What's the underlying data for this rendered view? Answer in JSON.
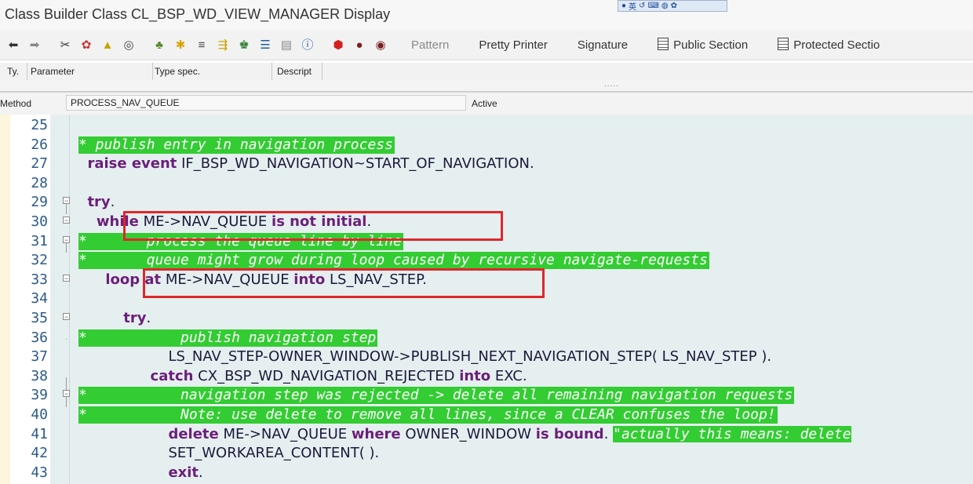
{
  "window": {
    "title": "Class Builder Class CL_BSP_WD_VIEW_MANAGER Display"
  },
  "ime_bar": {
    "icons": [
      "ime-logo-icon",
      "ime-lang-icon",
      "ime-punct-icon",
      "ime-keyboard-icon",
      "ime-mic-icon",
      "ime-settings-icon"
    ],
    "glyphs": [
      "●",
      "英",
      "↺",
      "⌨",
      "◍",
      "✿"
    ]
  },
  "toolbar": {
    "icons": [
      {
        "name": "back-arrow-icon",
        "glyph": "⬅",
        "color": "#333"
      },
      {
        "name": "forward-arrow-icon",
        "glyph": "➡",
        "color": "#888"
      },
      {
        "name": "other-object-icon",
        "glyph": "✂",
        "color": "#333"
      },
      {
        "name": "display-change-icon",
        "glyph": "✿",
        "color": "#c33"
      },
      {
        "name": "check-icon",
        "glyph": "▲",
        "color": "#c8a400"
      },
      {
        "name": "activate-icon",
        "glyph": "◎",
        "color": "#444"
      },
      {
        "name": "where-used-icon",
        "glyph": "♣",
        "color": "#5a8a2a"
      },
      {
        "name": "wand-icon",
        "glyph": "✱",
        "color": "#d9a400"
      },
      {
        "name": "display-object-list-icon",
        "glyph": "≡",
        "color": "#444"
      },
      {
        "name": "navigation-icon",
        "glyph": "⇶",
        "color": "#c8a400"
      },
      {
        "name": "hierarchy-icon",
        "glyph": "♚",
        "color": "#2a7a2a"
      },
      {
        "name": "stack-icon",
        "glyph": "☰",
        "color": "#1f5aa8"
      },
      {
        "name": "window-icon",
        "glyph": "▤",
        "color": "#888"
      },
      {
        "name": "info-icon",
        "glyph": "ⓘ",
        "color": "#1f5aa8"
      },
      {
        "name": "breakpoint-icon",
        "glyph": "⬢",
        "color": "#d31f1f"
      },
      {
        "name": "session-breakpoint-icon",
        "glyph": "●",
        "color": "#7a1f1f"
      },
      {
        "name": "external-breakpoint-icon",
        "glyph": "◉",
        "color": "#7a1f1f"
      }
    ],
    "buttons": {
      "pattern": "Pattern",
      "pretty_printer": "Pretty Printer",
      "signature": "Signature",
      "public_section": "Public Section",
      "protected_section": "Protected Sectio"
    }
  },
  "param_table": {
    "columns": [
      "Ty.",
      "Parameter",
      "Type spec.",
      "Descript"
    ]
  },
  "method_bar": {
    "label": "Method",
    "name": "PROCESS_NAV_QUEUE",
    "status": "Active"
  },
  "editor": {
    "lines": [
      {
        "n": "25"
      },
      {
        "n": "26",
        "comment": "* publish entry in navigation process"
      },
      {
        "n": "27",
        "code": [
          {
            "k": "ind",
            "t": "  "
          },
          {
            "k": "kw",
            "t": "raise event"
          },
          {
            "k": "op",
            "t": " IF_BSP_WD_NAVIGATION~START_OF_NAVIGATION."
          }
        ]
      },
      {
        "n": "28"
      },
      {
        "n": "29",
        "fold": "-",
        "code": [
          {
            "k": "ind",
            "t": "  "
          },
          {
            "k": "kw",
            "t": "try"
          },
          {
            "k": "op",
            "t": "."
          }
        ]
      },
      {
        "n": "30",
        "fold": "-",
        "code": [
          {
            "k": "ind",
            "t": "    "
          },
          {
            "k": "kw",
            "t": "while"
          },
          {
            "k": "op",
            "t": " ME->NAV_QUEUE "
          },
          {
            "k": "kw",
            "t": "is not initial"
          },
          {
            "k": "op",
            "t": "."
          }
        ]
      },
      {
        "n": "31",
        "fold": "-",
        "comment": "*       process the queue line by line"
      },
      {
        "n": "32",
        "comment": "*       queue might grow during loop caused by recursive navigate-requests"
      },
      {
        "n": "33",
        "fold": "-",
        "code": [
          {
            "k": "ind",
            "t": "      "
          },
          {
            "k": "kw",
            "t": "loop at"
          },
          {
            "k": "op",
            "t": " ME->NAV_QUEUE "
          },
          {
            "k": "kw",
            "t": "into"
          },
          {
            "k": "op",
            "t": " LS_NAV_STEP."
          }
        ]
      },
      {
        "n": "34"
      },
      {
        "n": "35",
        "fold": "-",
        "code": [
          {
            "k": "ind",
            "t": "          "
          },
          {
            "k": "kw",
            "t": "try"
          },
          {
            "k": "op",
            "t": "."
          }
        ]
      },
      {
        "n": "36",
        "comment": "*           publish navigation step"
      },
      {
        "n": "37",
        "code": [
          {
            "k": "ind",
            "t": "                    "
          },
          {
            "k": "op",
            "t": "LS_NAV_STEP-OWNER_WINDOW->PUBLISH_NEXT_NAVIGATION_STEP( LS_NAV_STEP )."
          }
        ]
      },
      {
        "n": "38",
        "code": [
          {
            "k": "ind",
            "t": "                "
          },
          {
            "k": "kw",
            "t": "catch"
          },
          {
            "k": "op",
            "t": " CX_BSP_WD_NAVIGATION_REJECTED "
          },
          {
            "k": "kw",
            "t": "into"
          },
          {
            "k": "op",
            "t": " EXC."
          }
        ]
      },
      {
        "n": "39",
        "fold": "-",
        "comment": "*           navigation step was rejected -> delete all remaining navigation requests"
      },
      {
        "n": "40",
        "comment": "*           Note: use delete to remove all lines, since a CLEAR confuses the loop!"
      },
      {
        "n": "41",
        "code": [
          {
            "k": "ind",
            "t": "                    "
          },
          {
            "k": "kw",
            "t": "delete"
          },
          {
            "k": "op",
            "t": " ME->NAV_QUEUE "
          },
          {
            "k": "kw",
            "t": "where"
          },
          {
            "k": "op",
            "t": " OWNER_WINDOW "
          },
          {
            "k": "kw",
            "t": "is bound"
          },
          {
            "k": "op",
            "t": ". "
          }
        ],
        "trailing_comment": "\"actually this means: delete"
      },
      {
        "n": "42",
        "code": [
          {
            "k": "ind",
            "t": "                    "
          },
          {
            "k": "op",
            "t": "SET_WORKAREA_CONTENT( )."
          }
        ]
      },
      {
        "n": "43",
        "code": [
          {
            "k": "ind",
            "t": "                    "
          },
          {
            "k": "kw",
            "t": "exit"
          },
          {
            "k": "op",
            "t": "."
          }
        ]
      }
    ]
  },
  "colors": {
    "comment_bg": "#33cc33",
    "keyword": "#6b1f7a",
    "highlight_box": "#e0262b",
    "editor_bg": "#e6eff0"
  }
}
